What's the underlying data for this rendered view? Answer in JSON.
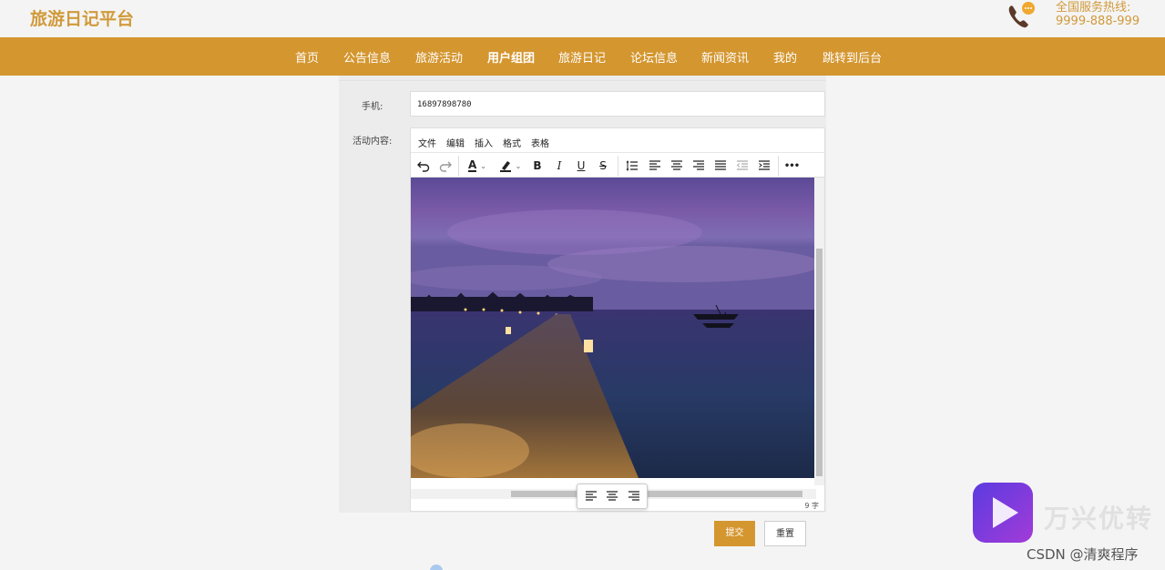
{
  "header": {
    "logo": "旅游日记平台",
    "hotline_label": "全国服务热线:",
    "hotline_number": "9999-888-999"
  },
  "nav": {
    "items": [
      "首页",
      "公告信息",
      "旅游活动",
      "用户组团",
      "旅游日记",
      "论坛信息",
      "新闻资讯",
      "我的",
      "跳转到后台"
    ],
    "active_index": 3
  },
  "form": {
    "phone_label": "手机:",
    "phone_value": "16897898780",
    "content_label": "活动内容:"
  },
  "editor": {
    "menu": [
      "文件",
      "编辑",
      "插入",
      "格式",
      "表格"
    ],
    "toolbar_icons": [
      "undo-icon",
      "redo-icon",
      "text-color-icon",
      "highlight-icon",
      "bold-icon",
      "italic-icon",
      "underline-icon",
      "strikethrough-icon",
      "line-height-icon",
      "align-left-icon",
      "align-center-icon",
      "align-right-icon",
      "align-justify-icon",
      "outdent-icon",
      "indent-icon",
      "more-icon"
    ],
    "toolbar_glyphs": {
      "bold": "B",
      "italic": "I",
      "underline": "U",
      "strike": "S",
      "text_color": "A",
      "more": "•••"
    },
    "word_count": "9 字",
    "image_alt": "Pier at dusk"
  },
  "buttons": {
    "submit": "提交",
    "reset": "重置"
  },
  "watermark": {
    "brand": "万兴优转",
    "csdn": "CSDN @清爽程序"
  },
  "colors": {
    "accent": "#d4962f",
    "logo": "#d19a3a"
  }
}
